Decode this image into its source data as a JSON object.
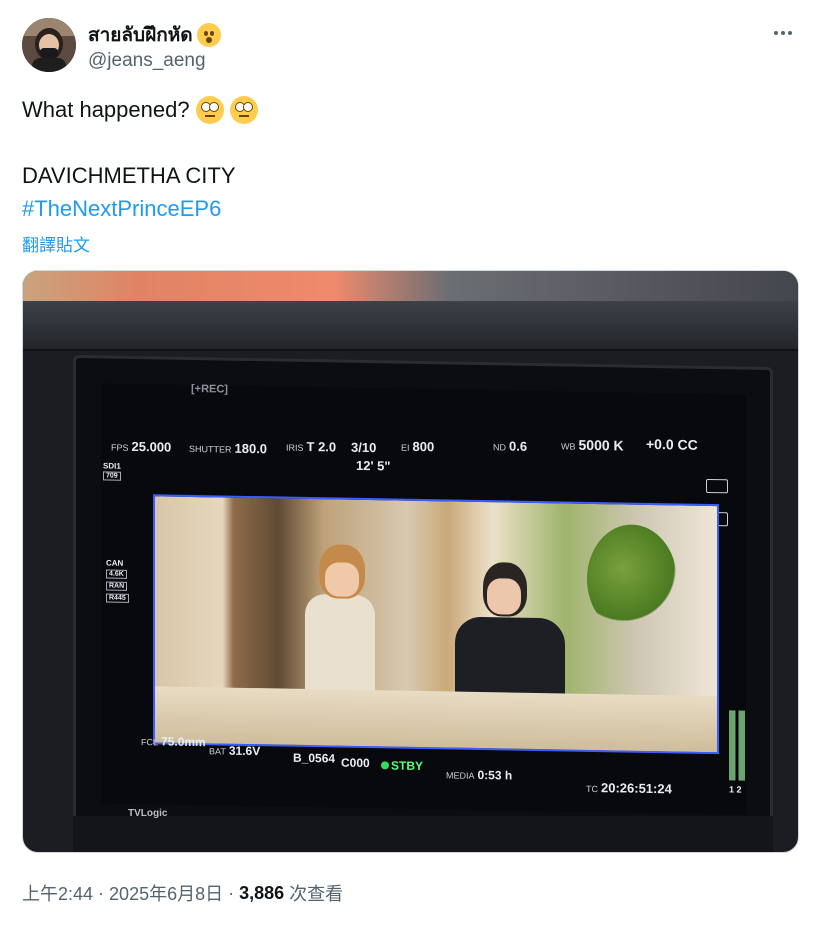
{
  "author": {
    "display_name": "สายลับฝึกหัด",
    "handle": "@jeans_aeng",
    "badge_icon": "astonished-face-emoji"
  },
  "tweet": {
    "line1": "What happened?",
    "line1_emojis": [
      "face-with-rolling-eyes-emoji",
      "face-with-rolling-eyes-emoji"
    ],
    "line2": "DAVICHMETHA CITY",
    "hashtag": "#TheNextPrinceEP6",
    "translate_label": "翻譯貼文"
  },
  "photo": {
    "hud": {
      "fps_label": "FPS",
      "fps": "25.000",
      "shutter_label": "SHUTTER",
      "shutter": "180.0",
      "iris_label": "IRIS",
      "iris": "T 2.0",
      "fraction": "3/10",
      "distance": "12' 5\"",
      "ei_label": "EI",
      "ei": "800",
      "nd_label": "ND",
      "nd": "0.6",
      "wb_label": "WB",
      "wb": "5000 K",
      "cc": "+0.0 CC",
      "top_left": "[+REC]",
      "sdi_label": "SDI1",
      "sdi_value": "709",
      "can_label": "CAN",
      "can_lines": [
        "4.6K",
        "RAN",
        "R445"
      ],
      "fcl_label": "FCL",
      "fcl": "75.0mm",
      "bat_label": "BAT",
      "bat": "31.6V",
      "clip": "B_0564",
      "clip_code": "C000",
      "status": "STBY",
      "media_label": "MEDIA",
      "media": "0:53 h",
      "tc_label": "TC",
      "tc": "20:26:51:24",
      "meter_label": "1 2",
      "brand": "TVLogic"
    }
  },
  "footer": {
    "time": "上午2:44",
    "separator": "·",
    "date": "2025年6月8日",
    "views_count": "3,886",
    "views_label": "次查看"
  },
  "colors": {
    "link": "#1d9bf0",
    "muted": "#536471",
    "text": "#0f1419"
  }
}
